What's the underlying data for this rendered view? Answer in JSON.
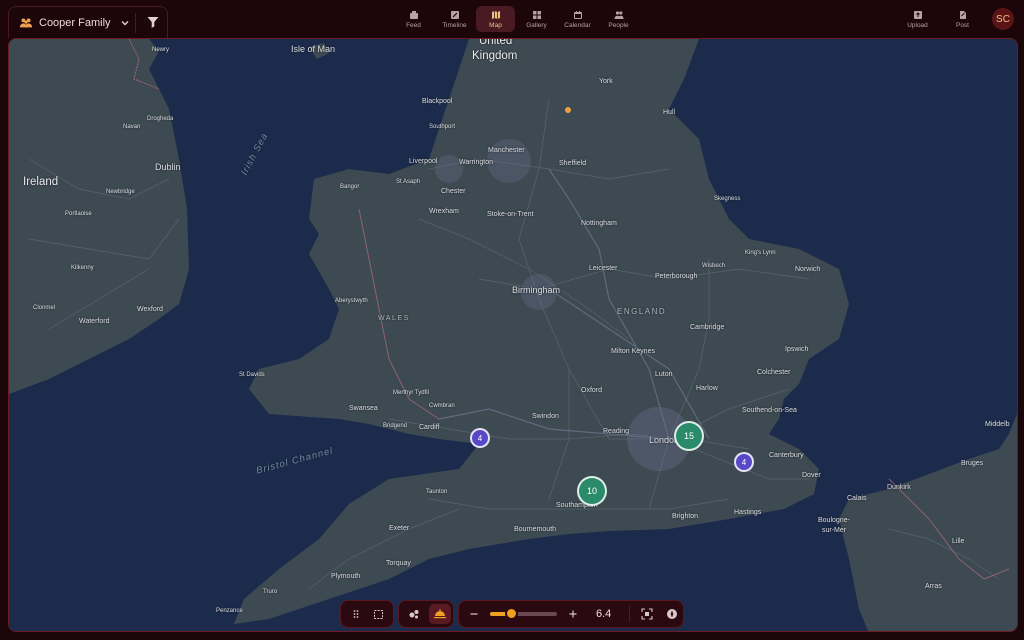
{
  "header": {
    "family_name": "Cooper Family",
    "nav": [
      {
        "label": "Feed",
        "icon": "feed-icon"
      },
      {
        "label": "Timeline",
        "icon": "timeline-icon"
      },
      {
        "label": "Map",
        "icon": "map-icon",
        "active": true
      },
      {
        "label": "Gallery",
        "icon": "gallery-icon"
      },
      {
        "label": "Calendar",
        "icon": "calendar-icon"
      },
      {
        "label": "People",
        "icon": "people-icon"
      }
    ],
    "upload_label": "Upload",
    "post_label": "Post",
    "avatar_initials": "SC"
  },
  "map": {
    "labels": {
      "isle_of_man": "Isle of Man",
      "united": "United",
      "kingdom": "Kingdom",
      "york": "York",
      "hull": "Hull",
      "blackpool": "Blackpool",
      "southport": "Southport",
      "manchester": "Manchester",
      "liverpool": "Liverpool",
      "warrington": "Warrington",
      "sheffield": "Sheffield",
      "bangor": "Bangor",
      "st_asaph": "St Asaph",
      "chester": "Chester",
      "wrexham": "Wrexham",
      "stoke": "Stoke-on-Trent",
      "nottingham": "Nottingham",
      "skegness": "Skegness",
      "kings_lynn": "King's Lynn",
      "wisbech": "Wisbech",
      "norwich": "Norwich",
      "leicester": "Leicester",
      "peterborough": "Peterborough",
      "birmingham": "Birmingham",
      "england": "ENGLAND",
      "aberystwyth": "Aberystwyth",
      "wales": "WALES",
      "cambridge": "Cambridge",
      "ipswich": "Ipswich",
      "milton_keynes": "Milton Keynes",
      "luton": "Luton",
      "colchester": "Colchester",
      "st_davids": "St Davids",
      "harlow": "Harlow",
      "oxford": "Oxford",
      "swansea": "Swansea",
      "merthyr": "Merthyr Tydfil",
      "cwmbran": "Cwmbran",
      "bridgend": "Bridgend",
      "cardiff": "Cardiff",
      "swindon": "Swindon",
      "reading": "Reading",
      "london": "London",
      "southend": "Southend-on-Sea",
      "canterbury": "Canterbury",
      "dover": "Dover",
      "taunton": "Taunton",
      "southampton": "Southampton",
      "brighton": "Brighton",
      "hastings": "Hastings",
      "bournemouth": "Bournemouth",
      "exeter": "Exeter",
      "torquay": "Torquay",
      "plymouth": "Plymouth",
      "penzance": "Penzance",
      "truro": "Truro",
      "ireland": "Ireland",
      "dublin": "Dublin",
      "newry": "Newry",
      "navan": "Navan",
      "drogheda": "Drogheda",
      "newbridge": "Newbridge",
      "portlaoise": "Portlaoise",
      "kilkenny": "Kilkenny",
      "waterford": "Waterford",
      "wexford": "Wexford",
      "clonmel": "Clonmel",
      "irish_sea": "Irish Sea",
      "bristol_channel": "Bristol Channel",
      "calais": "Calais",
      "dunkirk": "Dunkirk",
      "boulogne": "Boulogne-",
      "sur_mer": "sur-Mer",
      "bruges": "Bruges",
      "middelburg": "Middelb",
      "lille": "Lille",
      "arras": "Arras"
    },
    "clusters": [
      {
        "count": "15",
        "color": "green"
      },
      {
        "count": "10",
        "color": "green"
      },
      {
        "count": "4",
        "color": "blue"
      },
      {
        "count": "4",
        "color": "blue"
      }
    ]
  },
  "toolbar": {
    "zoom_value": "6.4",
    "zoom_fraction": 0.3
  }
}
